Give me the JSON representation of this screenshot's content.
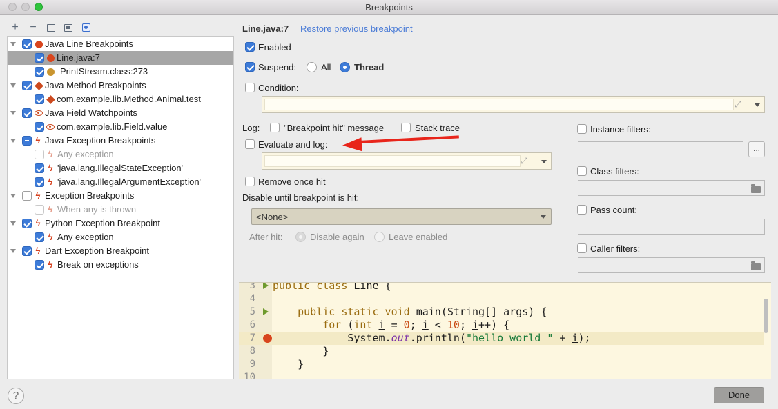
{
  "window": {
    "title": "Breakpoints"
  },
  "toolbar": {
    "add": "+",
    "remove": "−"
  },
  "tree": {
    "items": [
      {
        "label": "Java Line Breakpoints",
        "state": "on"
      },
      {
        "label": "Line.java:7",
        "state": "on"
      },
      {
        "label": "PrintStream.class:273",
        "state": "on"
      },
      {
        "label": "Java Method Breakpoints",
        "state": "on"
      },
      {
        "label": "com.example.lib.Method.Animal.test",
        "state": "on"
      },
      {
        "label": "Java Field Watchpoints",
        "state": "on"
      },
      {
        "label": "com.example.lib.Field.value",
        "state": "on"
      },
      {
        "label": "Java Exception Breakpoints",
        "state": "partial"
      },
      {
        "label": "Any exception",
        "state": "off"
      },
      {
        "label": "'java.lang.IllegalStateException'",
        "state": "on"
      },
      {
        "label": "'java.lang.IllegalArgumentException'",
        "state": "on"
      },
      {
        "label": "Exception Breakpoints",
        "state": "off"
      },
      {
        "label": "When any is thrown",
        "state": "off"
      },
      {
        "label": "Python Exception Breakpoint",
        "state": "on"
      },
      {
        "label": "Any exception",
        "state": "on"
      },
      {
        "label": "Dart Exception Breakpoint",
        "state": "on"
      },
      {
        "label": "Break on exceptions",
        "state": "on"
      }
    ]
  },
  "detail": {
    "header": "Line.java:7",
    "restore_link": "Restore previous breakpoint",
    "enabled": "Enabled",
    "suspend": "Suspend:",
    "all": "All",
    "thread": "Thread",
    "condition": "Condition:",
    "log": "Log:",
    "hit_message": "\"Breakpoint hit\" message",
    "stack_trace": "Stack trace",
    "evaluate_and_log": "Evaluate and log:",
    "remove_once_hit": "Remove once hit",
    "disable_until": "Disable until breakpoint is hit:",
    "none_option": "<None>",
    "after_hit": "After hit:",
    "disable_again": "Disable again",
    "leave_enabled": "Leave enabled",
    "instance_filters": "Instance filters:",
    "dots": "...",
    "class_filters": "Class filters:",
    "pass_count": "Pass count:",
    "caller_filters": "Caller filters:"
  },
  "editor": {
    "line_numbers": [
      "3",
      "4",
      "5",
      "6",
      "7",
      "8",
      "9",
      "10"
    ],
    "current_line": "7"
  },
  "footer": {
    "help": "?",
    "done": "Done"
  },
  "colors": {
    "accent": "#3d7bd8",
    "link": "#4a7bd6",
    "breakpoint": "#d8451d",
    "annotation_arrow": "#e8251b"
  }
}
